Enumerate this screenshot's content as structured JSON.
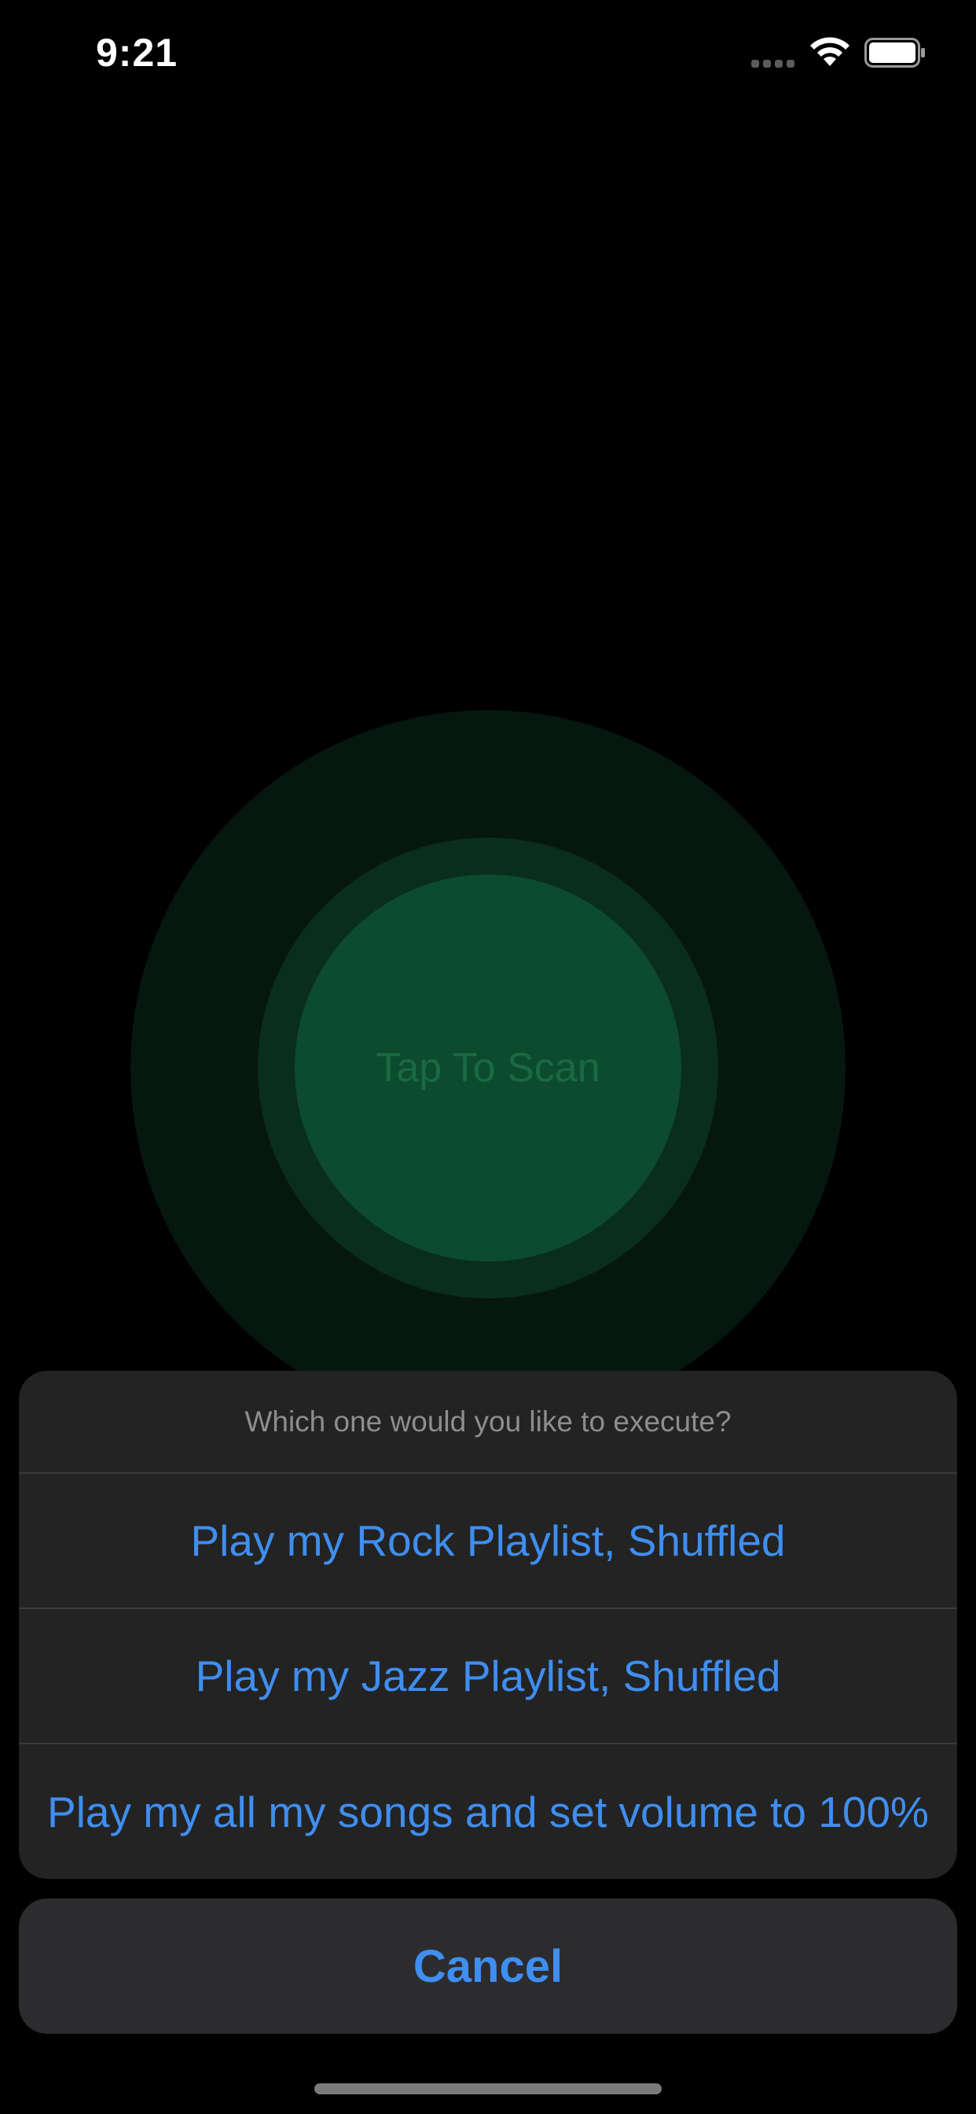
{
  "status_bar": {
    "time": "9:21",
    "icons": [
      "cellular-signal-icon",
      "wifi-icon",
      "battery-icon"
    ]
  },
  "scan": {
    "label": "Tap To Scan",
    "colors": {
      "outer": "#06170f",
      "middle": "#0a2e1e",
      "inner": "#0c4b2e"
    }
  },
  "action_sheet": {
    "title": "Which one would you like to execute?",
    "options": [
      {
        "label": "Play my Rock Playlist, Shuffled"
      },
      {
        "label": "Play my Jazz Playlist, Shuffled"
      },
      {
        "label": "Play my all my songs and set volume to 100%"
      }
    ],
    "cancel_label": "Cancel",
    "accent_color": "#3f8ef0"
  }
}
